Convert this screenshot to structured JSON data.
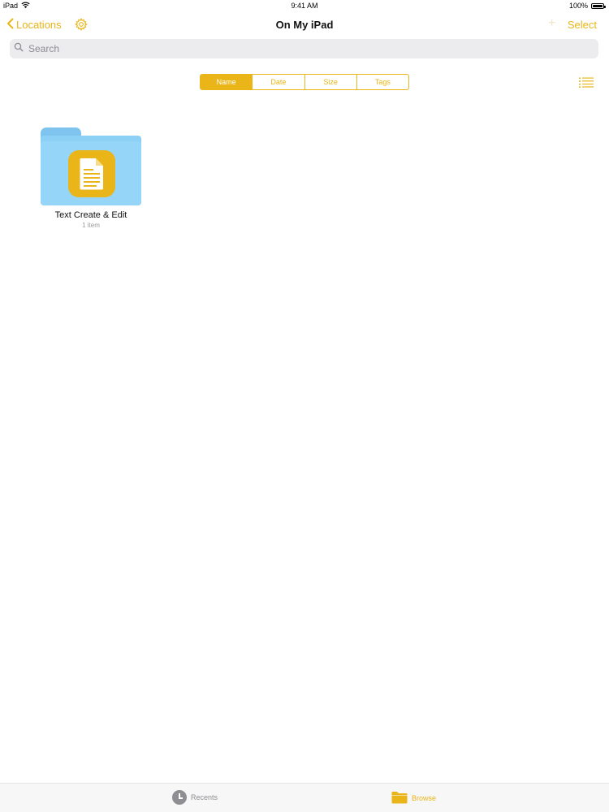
{
  "status_bar": {
    "device": "iPad",
    "time": "9:41 AM",
    "battery": "100%"
  },
  "nav": {
    "back_label": "Locations",
    "title": "On My iPad",
    "add_label": "+",
    "select_label": "Select"
  },
  "search": {
    "placeholder": "Search"
  },
  "sort": {
    "options": [
      "Name",
      "Date",
      "Size",
      "Tags"
    ],
    "selected": "Name"
  },
  "items": [
    {
      "name": "Text Create & Edit",
      "count": "1 item"
    }
  ],
  "tab_bar": {
    "recents": "Recents",
    "browse": "Browse",
    "selected": "Browse"
  },
  "colors": {
    "accent": "#E9B519",
    "folder": "#8DD0F5",
    "search_bg": "#ECECEE",
    "inactive": "#8e8e93"
  },
  "icons": {
    "back": "chevron-left-icon",
    "settings": "gear-icon",
    "search": "search-icon",
    "list_view": "list-icon",
    "folder": "folder-icon",
    "app": "document-icon",
    "recents": "clock-icon",
    "browse": "folder-icon"
  }
}
